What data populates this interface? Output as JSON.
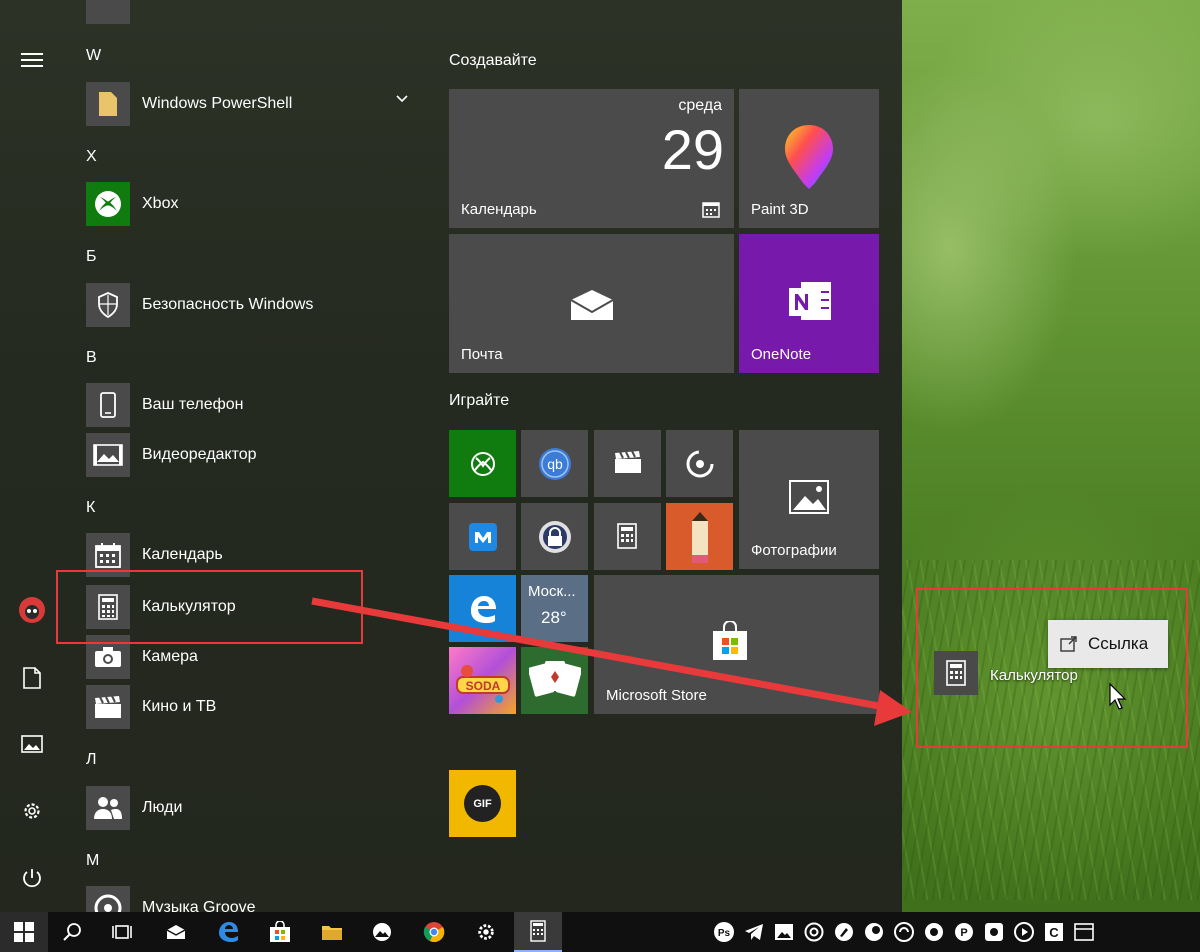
{
  "start_menu": {
    "app_list": {
      "letters": {
        "w": "W",
        "x": "X",
        "b": "Б",
        "v": "В",
        "k": "К",
        "l": "Л",
        "m": "М"
      },
      "apps": {
        "powershell": "Windows PowerShell",
        "xbox": "Xbox",
        "security": "Безопасность Windows",
        "phone": "Ваш телефон",
        "video_editor": "Видеоредактор",
        "calendar": "Календарь",
        "calculator": "Калькулятор",
        "camera": "Камера",
        "movies": "Кино и ТВ",
        "people": "Люди",
        "groove": "Музыка Groove"
      }
    },
    "tiles": {
      "group_create": "Создавайте",
      "group_play": "Играйте",
      "calendar_day_name": "среда",
      "calendar_day_number": "29",
      "calendar_label": "Календарь",
      "paint3d_label": "Paint 3D",
      "mail_label": "Почта",
      "onenote_label": "OneNote",
      "photos_label": "Фотографии",
      "weather_city": "Моск...",
      "weather_temp": "28°",
      "store_label": "Microsoft Store",
      "gif_label": "GIF"
    }
  },
  "desktop": {
    "shortcut_label": "Калькулятор",
    "context_link_label": "Ссылка"
  },
  "colors": {
    "accent_xbox": "#107c10",
    "onenote": "#7719aa",
    "highlight_red": "#e8393b",
    "gif_tile": "#f2b800"
  }
}
